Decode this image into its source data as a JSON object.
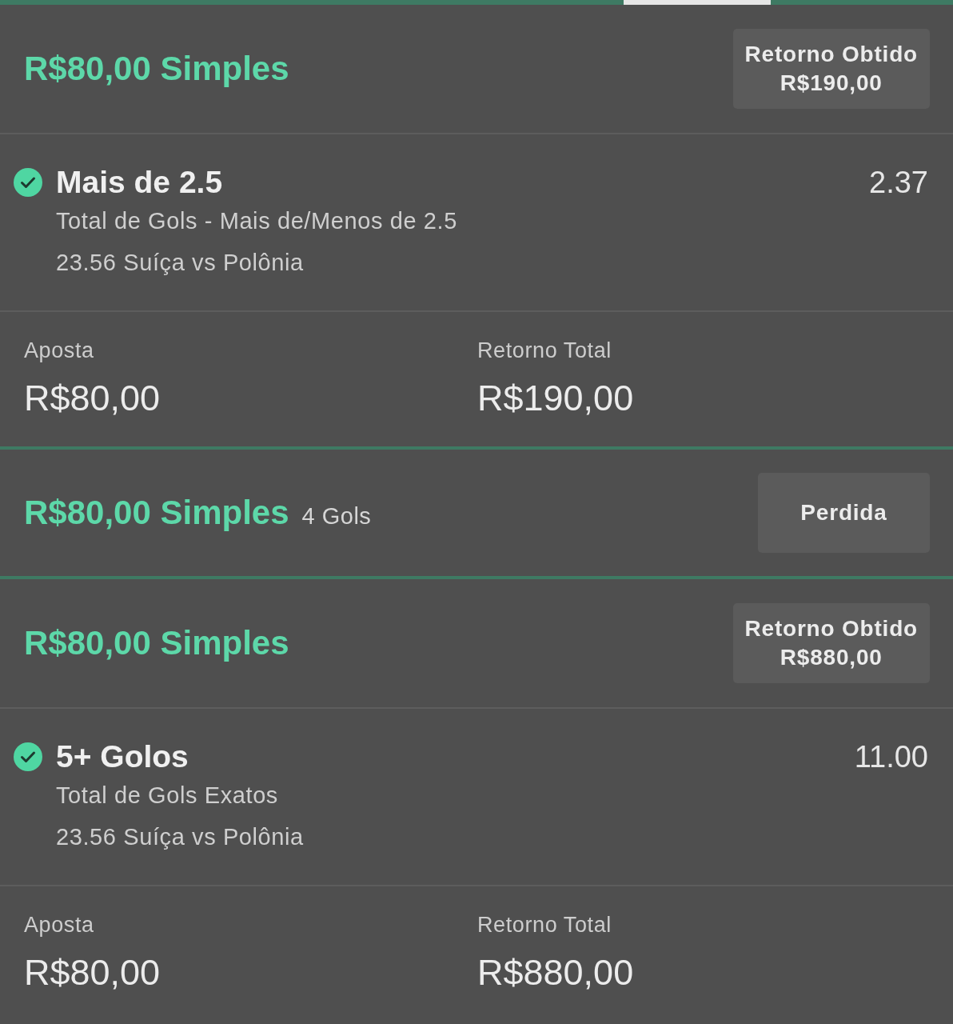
{
  "bets": [
    {
      "title": "R$80,00 Simples",
      "status": {
        "label": "Retorno Obtido",
        "amount": "R$190,00"
      },
      "selections": [
        {
          "won": true,
          "name": "Mais de 2.5",
          "odds": "2.37",
          "market": "Total de Gols - Mais de/Menos de 2.5",
          "match": "23.56 Suíça vs Polônia"
        }
      ],
      "summary": {
        "stake_label": "Aposta",
        "stake": "R$80,00",
        "return_label": "Retorno Total",
        "return": "R$190,00"
      }
    },
    {
      "title": "R$80,00 Simples",
      "subtitle": "4 Gols",
      "status": {
        "label": "Perdida"
      }
    },
    {
      "title": "R$80,00 Simples",
      "status": {
        "label": "Retorno Obtido",
        "amount": "R$880,00"
      },
      "selections": [
        {
          "won": true,
          "name": "5+ Golos",
          "odds": "11.00",
          "market": "Total de Gols Exatos",
          "match": "23.56 Suíça vs Polônia"
        }
      ],
      "summary": {
        "stake_label": "Aposta",
        "stake": "R$80,00",
        "return_label": "Retorno Total",
        "return": "R$880,00"
      }
    }
  ]
}
